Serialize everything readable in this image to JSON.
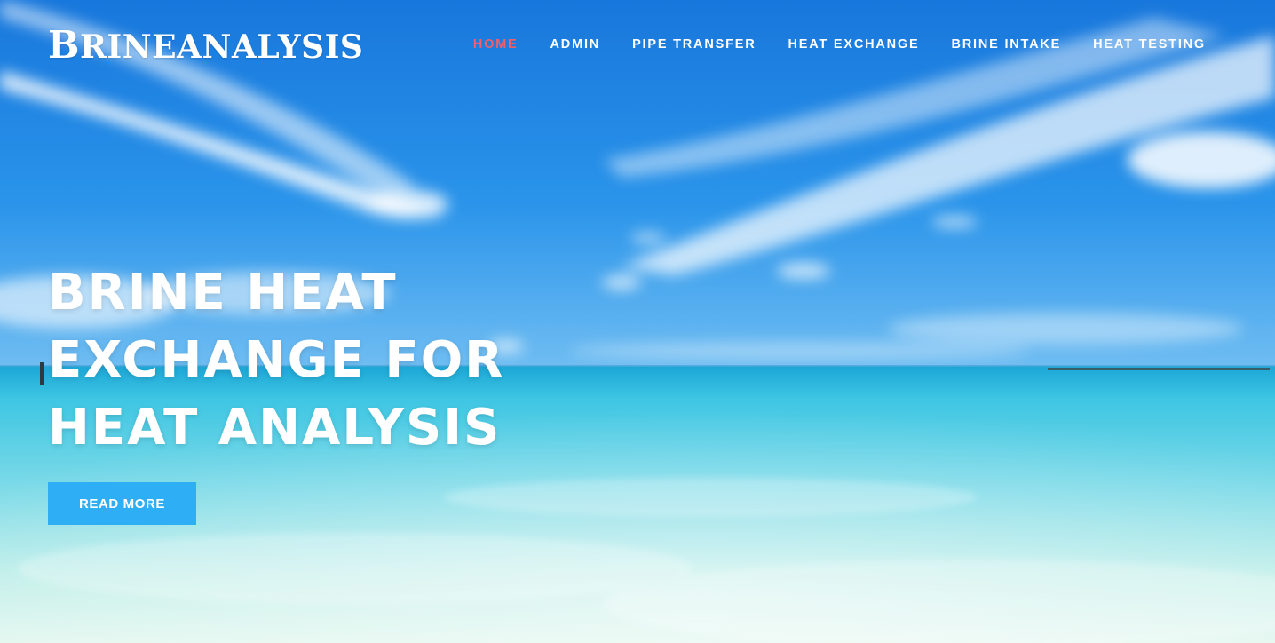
{
  "brand": {
    "logo_first": "B",
    "logo_rest": "RINEANALYSIS"
  },
  "nav": {
    "items": [
      {
        "label": "HOME",
        "active": true
      },
      {
        "label": "ADMIN",
        "active": false
      },
      {
        "label": "PIPE TRANSFER",
        "active": false
      },
      {
        "label": "HEAT EXCHANGE",
        "active": false
      },
      {
        "label": "BRINE INTAKE",
        "active": false
      },
      {
        "label": "HEAT TESTING",
        "active": false
      }
    ]
  },
  "hero": {
    "headline_lines": [
      "BRINE HEAT",
      "EXCHANGE FOR",
      "HEAT ANALYSIS"
    ],
    "cta_label": "READ MORE"
  },
  "colors": {
    "nav_active": "#f0606a",
    "cta_background": "#2eaef5",
    "sky_top": "#1a7fe0",
    "sea": "#5fd4e6"
  }
}
